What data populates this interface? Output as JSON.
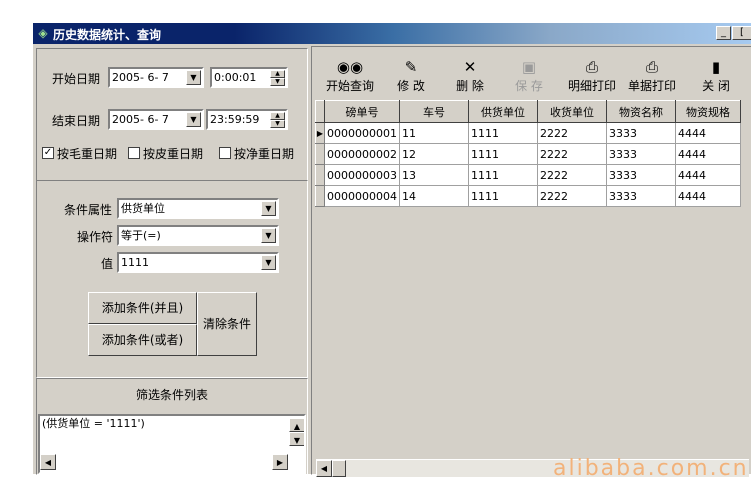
{
  "window": {
    "title": "历史数据统计、查询",
    "min_label": "_",
    "close_label": "["
  },
  "date_range": {
    "start_label": "开始日期",
    "start_date": "2005- 6- 7",
    "start_time": "0:00:01",
    "end_label": "结束日期",
    "end_date": "2005- 6- 7",
    "end_time": "23:59:59"
  },
  "date_filters": [
    {
      "label": "按毛重日期",
      "checked": true
    },
    {
      "label": "按皮重日期",
      "checked": false
    },
    {
      "label": "按净重日期",
      "checked": false
    }
  ],
  "condition": {
    "attribute_label": "条件属性",
    "attribute_value": "供货单位",
    "operator_label": "操作符",
    "operator_value": "等于(=)",
    "value_label": "值",
    "value": "1111",
    "add_and_label": "添加条件(并且)",
    "add_or_label": "添加条件(或者)",
    "clear_label": "清除条件"
  },
  "filter_list": {
    "title": "筛选条件列表",
    "items": [
      "(供货单位 = '1111')"
    ]
  },
  "toolbar": [
    {
      "label": "开始查询",
      "icon": "binoculars-icon",
      "enabled": true
    },
    {
      "label": "修 改",
      "icon": "edit-doc-icon",
      "enabled": true
    },
    {
      "label": "删 除",
      "icon": "delete-x-icon",
      "enabled": true
    },
    {
      "label": "保 存",
      "icon": "save-icon",
      "enabled": false
    },
    {
      "label": "明细打印",
      "icon": "printer-icon",
      "enabled": true
    },
    {
      "label": "单据打印",
      "icon": "printer-icon",
      "enabled": true
    },
    {
      "label": "关 闭",
      "icon": "exit-door-icon",
      "enabled": true
    }
  ],
  "table": {
    "columns": [
      "磅单号",
      "车号",
      "供货单位",
      "收货单位",
      "物资名称",
      "物资规格"
    ],
    "rows": [
      [
        "0000000001",
        "11",
        "1111",
        "2222",
        "3333",
        "4444"
      ],
      [
        "0000000002",
        "12",
        "1111",
        "2222",
        "3333",
        "4444"
      ],
      [
        "0000000003",
        "13",
        "1111",
        "2222",
        "3333",
        "4444"
      ],
      [
        "0000000004",
        "14",
        "1111",
        "2222",
        "3333",
        "4444"
      ]
    ]
  },
  "watermark": "alibaba.com.cn"
}
